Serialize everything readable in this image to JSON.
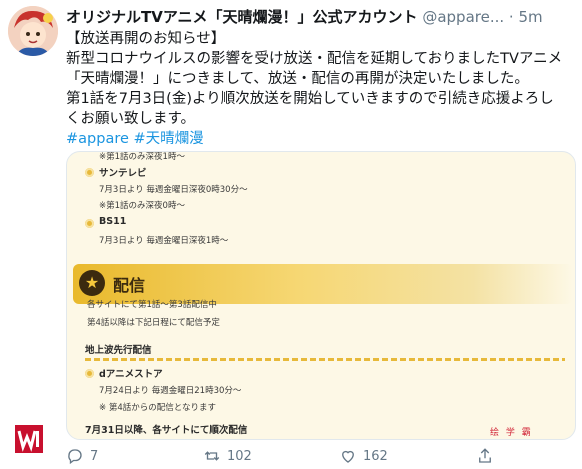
{
  "tweet": {
    "display_name": "オリジナルTVアニメ「天晴爛漫！」公式アカウント",
    "handle": "@appare...",
    "dot": "·",
    "time": "5m",
    "text_lines": [
      "【放送再開のお知らせ】",
      "新型コロナウイルスの影響を受け放送・配信を延期しておりましたTVアニメ「天晴爛漫！」につきまして、放送・配信の再開が決定いたしました。",
      "第1話を7月3日(金)より順次放送を開始していきますので引続き応援よろしくお願い致します。"
    ],
    "hashtags": "#appare #天晴爛漫"
  },
  "card": {
    "top_note": "※第1話のみ深夜1時〜",
    "station1_name": "サンテレビ",
    "station1_line1": "7月3日より 毎週金曜日深夜0時30分〜",
    "station1_line2": "※第1話のみ深夜0時〜",
    "station2_name": "BS11",
    "station2_line1": "7月3日より 毎週金曜日深夜1時〜",
    "banner_label": "配信",
    "stream_line1": "各サイトにて第1話〜第3話配信中",
    "stream_line2": "第4話以降は下記日程にて配信予定",
    "section_title": "地上波先行配信",
    "service_name": "dアニメストア",
    "service_line1": "7月24日より 毎週金曜日21時30分〜",
    "service_line2": "※ 第4話からの配信となります",
    "bottom_line": "7月31日以降、各サイトにて順次配信"
  },
  "actions": {
    "reply_count": "7",
    "retweet_count": "102",
    "like_count": "162"
  },
  "watermark_text": "绘 学 霸",
  "colors": {
    "link": "#1b95e0",
    "meta": "#657786",
    "card_bg": "#fdf8e6",
    "banner_gold": "#e9b92c"
  }
}
